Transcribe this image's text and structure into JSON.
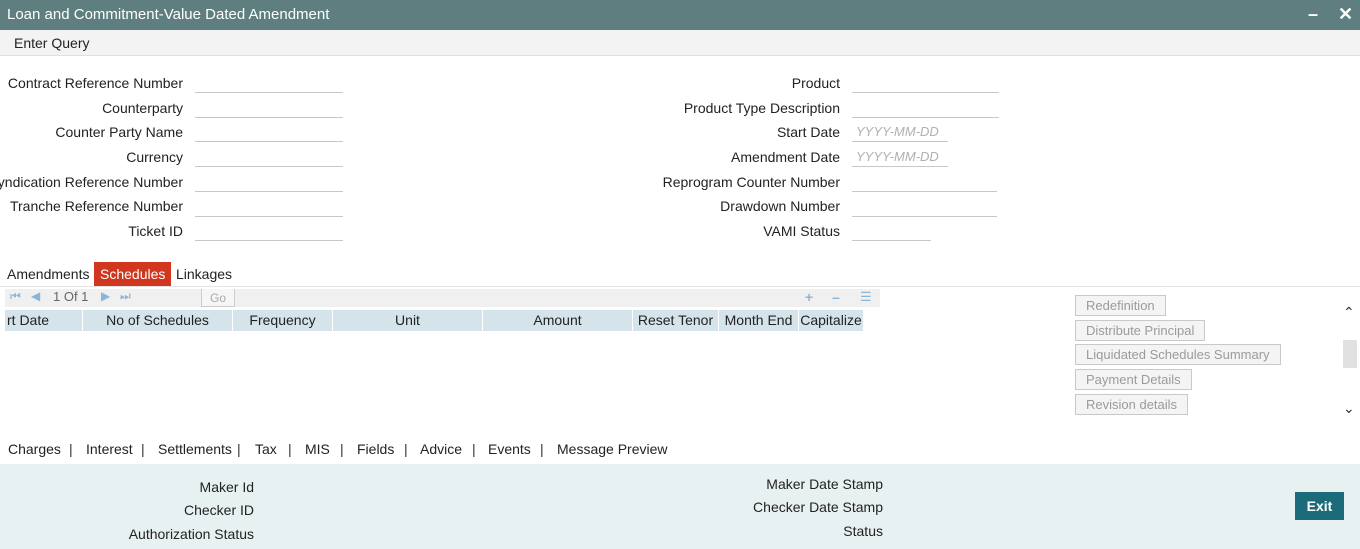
{
  "window": {
    "title": "Loan and Commitment-Value Dated Amendment",
    "minimize_icon": "minimize-icon",
    "close_icon": "close-icon"
  },
  "menu": {
    "enter_query": "Enter Query"
  },
  "fields_left": [
    {
      "label": "Contract Reference Number",
      "value": "",
      "placeholder": ""
    },
    {
      "label": "Counterparty",
      "value": "",
      "placeholder": ""
    },
    {
      "label": "Counter Party Name",
      "value": "",
      "placeholder": ""
    },
    {
      "label": "Currency",
      "value": "",
      "placeholder": ""
    },
    {
      "label": "Syndication Reference Number",
      "value": "",
      "placeholder": ""
    },
    {
      "label": "Tranche Reference Number",
      "value": "",
      "placeholder": ""
    },
    {
      "label": "Ticket ID",
      "value": "",
      "placeholder": ""
    }
  ],
  "fields_right": [
    {
      "label": "Product",
      "value": "",
      "placeholder": ""
    },
    {
      "label": "Product Type Description",
      "value": "",
      "placeholder": ""
    },
    {
      "label": "Start Date",
      "value": "",
      "placeholder": "YYYY-MM-DD"
    },
    {
      "label": "Amendment Date",
      "value": "",
      "placeholder": "YYYY-MM-DD"
    },
    {
      "label": "Reprogram Counter Number",
      "value": "",
      "placeholder": ""
    },
    {
      "label": "Drawdown Number",
      "value": "",
      "placeholder": ""
    },
    {
      "label": "VAMI Status",
      "value": "",
      "placeholder": ""
    }
  ],
  "tabs": [
    {
      "label": "Amendments",
      "active": false
    },
    {
      "label": "Schedules",
      "active": true
    },
    {
      "label": "Linkages",
      "active": false
    }
  ],
  "grid": {
    "page_info": "1 Of 1",
    "go_label": "Go",
    "columns": [
      "rt Date",
      "No of Schedules",
      "Frequency",
      "Unit",
      "Amount",
      "Reset Tenor",
      "Month End",
      "Capitalize"
    ],
    "rows": []
  },
  "side_buttons": [
    "Redefinition",
    "Distribute Principal",
    "Liquidated Schedules Summary",
    "Payment Details",
    "Revision details"
  ],
  "subsystems": [
    "Charges",
    "Interest",
    "Settlements",
    "Tax",
    "MIS",
    "Fields",
    "Advice",
    "Events",
    "Message Preview"
  ],
  "footer": {
    "maker_id": "Maker Id",
    "checker_id": "Checker ID",
    "authorization_status": "Authorization Status",
    "maker_date_stamp": "Maker Date Stamp",
    "checker_date_stamp": "Checker Date Stamp",
    "status": "Status",
    "exit_label": "Exit"
  },
  "colors": {
    "title_bar": "#5f7e7f",
    "active_tab": "#d1371f",
    "grid_header": "#d4e4ea",
    "footer_bg": "#e8f1f2",
    "exit_button": "#1b6b7b"
  }
}
